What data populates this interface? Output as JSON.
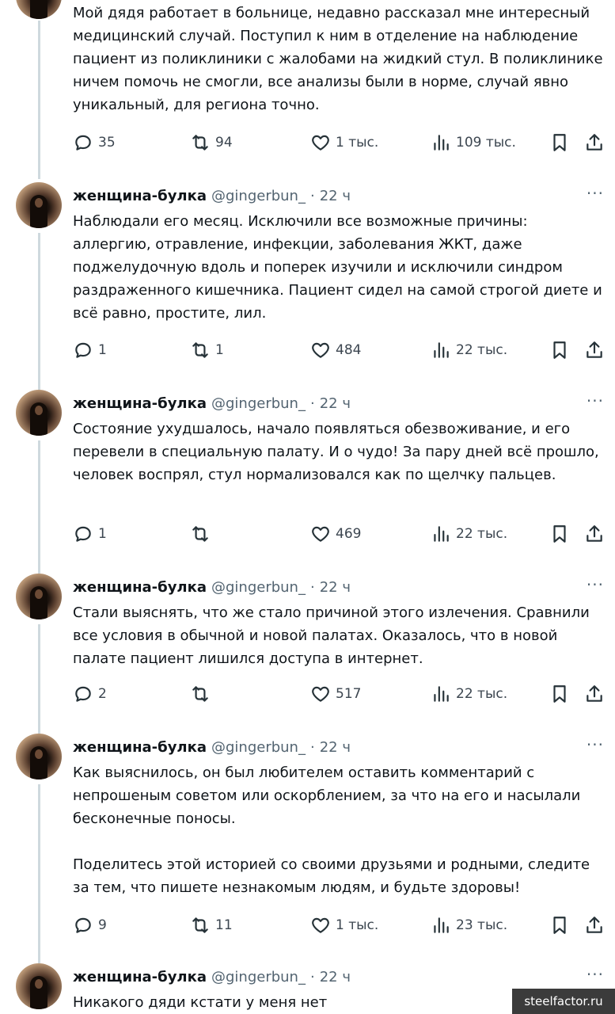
{
  "tweets": [
    {
      "show_header": false,
      "name": "",
      "handle": "",
      "time": "",
      "text": "Мой дядя работает в больнице, недавно рассказал мне интересный медицинский случай. Поступил к ним в отделение на наблюдение пациент из поликлиники с жалобами на жидкий стул. В поликлинике ничем помочь не смогли, все анализы были в норме, случай явно уникальный, для региона точно.",
      "replies": "35",
      "retweets": "94",
      "likes": "1 тыс.",
      "views": "109 тыс."
    },
    {
      "show_header": true,
      "name": "женщина-булка",
      "handle": "@gingerbun_",
      "time": "22 ч",
      "text": "Наблюдали его месяц. Исключили все возможные причины: аллергию, отравление, инфекции, заболевания ЖКТ, даже поджелудочную вдоль и поперек изучили и исключили синдром раздраженного кишечника. Пациент сидел на самой строгой диете и всё равно, простите, лил.",
      "replies": "1",
      "retweets": "1",
      "likes": "484",
      "views": "22 тыс."
    },
    {
      "show_header": true,
      "name": "женщина-булка",
      "handle": "@gingerbun_",
      "time": "22 ч",
      "text": "Состояние ухудшалось, начало появляться обезвоживание, и его перевели в специальную палату. И о чудо! За пару дней всё прошло, человек воспрял, стул нормализовался как по щелчку пальцев.",
      "replies": "1",
      "retweets": "",
      "likes": "469",
      "views": "22 тыс."
    },
    {
      "show_header": true,
      "name": "женщина-булка",
      "handle": "@gingerbun_",
      "time": "22 ч",
      "text": "Стали выяснять, что же стало причиной этого излечения. Сравнили все условия в обычной и новой палатах. Оказалось, что в новой палате пациент лишился доступа в интернет.",
      "replies": "2",
      "retweets": "",
      "likes": "517",
      "views": "22 тыс."
    },
    {
      "show_header": true,
      "name": "женщина-булка",
      "handle": "@gingerbun_",
      "time": "22 ч",
      "text": "Как выяснилось, он был любителем оставить комментарий с непрошеным советом или оскорблением, за что на его и насылали бесконечные поносы.\n\nПоделитесь этой историей со своими друзьями и родными, следите за тем, что пишете незнакомым людям, и будьте здоровы!",
      "replies": "9",
      "retweets": "11",
      "likes": "1 тыс.",
      "views": "23 тыс."
    },
    {
      "show_header": true,
      "name": "женщина-булка",
      "handle": "@gingerbun_",
      "time": "22 ч",
      "text": "Никакого дяди кстати у меня нет",
      "replies": "",
      "retweets": "",
      "likes": "",
      "views": ""
    }
  ],
  "header_separator": "·",
  "more_label": "···",
  "watermark": "steelfactor.ru"
}
